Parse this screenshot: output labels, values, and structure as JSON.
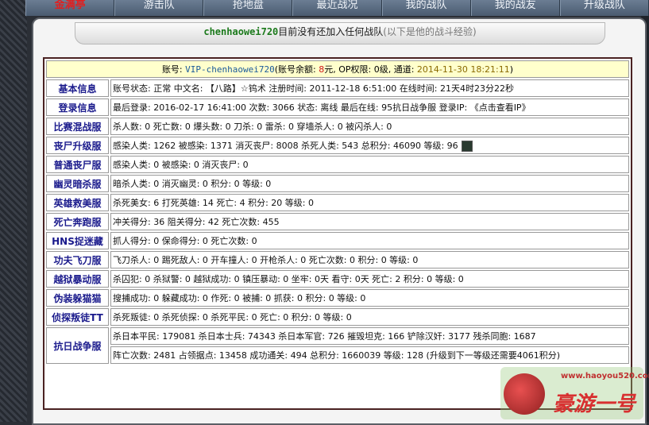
{
  "nav": [
    {
      "label": "金满亭",
      "active": true
    },
    {
      "label": "游击队",
      "active": false
    },
    {
      "label": "抢地盘",
      "active": false
    },
    {
      "label": "最近战况",
      "active": false
    },
    {
      "label": "我的战队",
      "active": false
    },
    {
      "label": "我的战友",
      "active": false
    },
    {
      "label": "升级战队",
      "active": false
    }
  ],
  "banner": {
    "username": "chenhaowei720",
    "message": "目前没有还加入任何战队",
    "hint": "(以下是他的战斗经验)"
  },
  "account": {
    "prefix": "账号: ",
    "vip": "VIP-chenhaowei720",
    "balance_label": "(账号余额: ",
    "balance": "8",
    "balance_unit": "元, OP权限: 0级, 通道: ",
    "date": "2014-11-30 18:21:11",
    "close": ")"
  },
  "rows": [
    {
      "label": "基本信息",
      "text": "账号状态: 正常 中文名: 【八路】☆钨术 注册时间: 2011-12-18 6:51:00 在线时间: 21天4时23分22秒"
    },
    {
      "label": "登录信息",
      "text": "最后登录: 2016-02-17 16:41:00 次数: 3066 状态: 离线 最后在线: 95抗日战争服 登录IP: 《点击查看IP》"
    },
    {
      "label": "比赛混战服",
      "text": "杀人数: 0 死亡数: 0 爆头数: 0 刀杀: 0 雷杀: 0 穿墙杀人: 0 被闪杀人: 0"
    },
    {
      "label": "丧尸升级服",
      "text": "感染人类: 1262 被感染: 1371 消灭丧尸: 8008 杀死人类: 543 总积分: 46090 等级: 96"
    },
    {
      "label": "普通丧尸服",
      "text": "感染人类: 0 被感染: 0 消灭丧尸: 0"
    },
    {
      "label": "幽灵暗杀服",
      "text": "暗杀人类: 0 消灭幽灵: 0 积分: 0 等级: 0"
    },
    {
      "label": "英雄救美服",
      "text": "杀死美女: 6 打死英雄: 14 死亡: 4 积分: 20 等级: 0"
    },
    {
      "label": "死亡奔跑服",
      "text": "冲关得分: 36 阻关得分: 42 死亡次数: 455"
    },
    {
      "label": "HNS捉迷藏",
      "text": "抓人得分: 0 保命得分: 0 死亡次数: 0"
    },
    {
      "label": "功夫飞刀服",
      "text": "飞刀杀人: 0 踢死敌人: 0 开车撞人: 0 开枪杀人: 0 死亡次数: 0 积分: 0 等级: 0"
    },
    {
      "label": "越狱暴动服",
      "text": "杀囚犯: 0 杀狱警: 0 越狱成功: 0 镇压暴动: 0 坐牢: 0天 看守: 0天 死亡: 2 积分: 0 等级: 0"
    },
    {
      "label": "伪装躲猫猫",
      "text": "搜捕成功: 0 躲藏成功: 0 作死: 0 被捕: 0 抓获: 0 积分: 0 等级: 0"
    },
    {
      "label": "侦探叛徒TT",
      "text": "杀死叛徒: 0 杀死侦探: 0 杀死平民: 0 死亡: 0 积分: 0 等级: 0"
    }
  ],
  "war": {
    "label": "抗日战争服",
    "line1": "杀日本平民: 179081 杀日本士兵: 74343 杀日本军官: 726 摧毁坦克: 166 铲除汉奸: 3177 残杀同胞: 1687",
    "line2": "阵亡次数: 2481 占领据点: 13458 成功通关: 494 总积分: 1660039 等级: 128 (升级到下一等级还需要4061积分)"
  },
  "watermark": {
    "site": "www.haoyou520.com",
    "brand": "豪游一号"
  },
  "icons": {
    "avatar": "player-avatar-icon"
  }
}
